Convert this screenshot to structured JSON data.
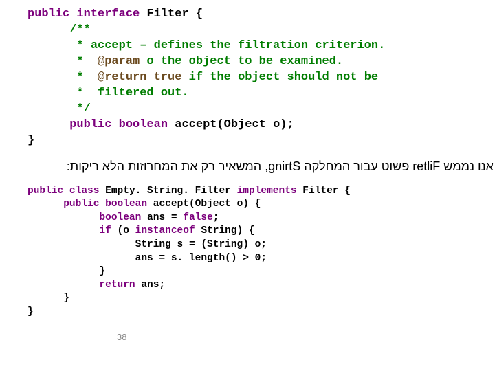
{
  "code1": {
    "l1_a": "public",
    "l1_b": " ",
    "l1_c": "interface",
    "l1_d": " Filter {",
    "l2": "      /**",
    "l3": "       * accept – defines the filtration criterion.",
    "l4_a": "       *  ",
    "l4_b": "@param",
    "l4_c": " o the object to be examined.",
    "l5_a": "       *  ",
    "l5_b": "@return",
    "l5_c": " ",
    "l5_d": "true",
    "l5_e": " if the object should not be",
    "l6": "       *  filtered out.",
    "l7": "       */",
    "l8_a": "      ",
    "l8_b": "public",
    "l8_c": " ",
    "l8_d": "boolean",
    "l8_e": " accept(Object o);",
    "l9": "}"
  },
  "hebrew": "אנו נממש Filter פשוט עבור המחלקה String, המשאיר רק את המחרוזות הלא ריקות:",
  "code2": {
    "l1_a": "public",
    "l1_b": " ",
    "l1_c": "class",
    "l1_d": " Empty. String. Filter ",
    "l1_e": "implements",
    "l1_f": " Filter {",
    "l2_a": "      ",
    "l2_b": "public",
    "l2_c": " ",
    "l2_d": "boolean",
    "l2_e": " accept(Object o) {",
    "l3_a": "            ",
    "l3_b": "boolean",
    "l3_c": " ans = ",
    "l3_d": "false",
    "l3_e": ";",
    "l4_a": "            ",
    "l4_b": "if",
    "l4_c": " (o ",
    "l4_d": "instanceof",
    "l4_e": " String) {",
    "l5": "                  String s = (String) o;",
    "l6": "                  ans = s. length() > 0;",
    "l7": "            }",
    "l8_a": "            ",
    "l8_b": "return",
    "l8_c": " ans;",
    "l9": "      }",
    "l10": "}"
  },
  "page": "38"
}
